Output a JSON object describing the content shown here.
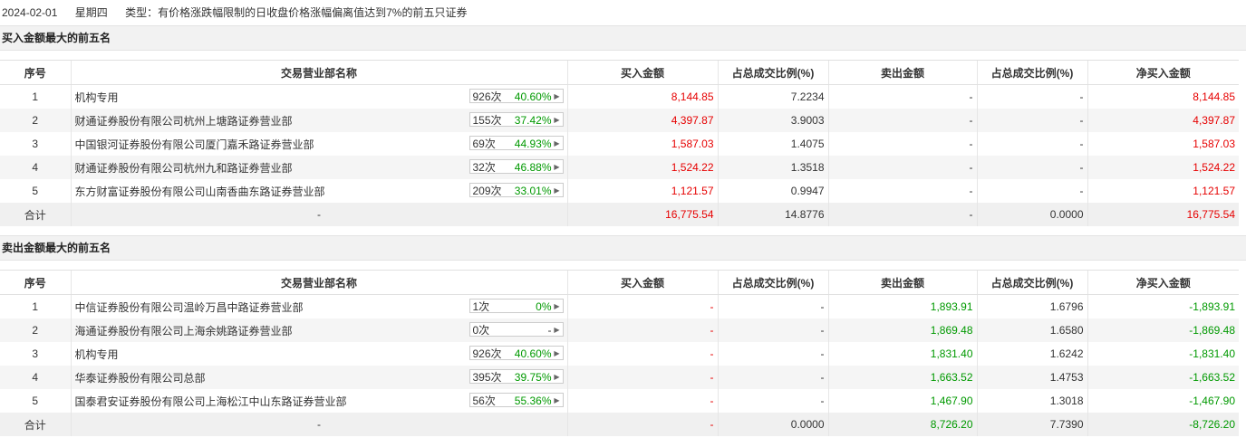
{
  "header": {
    "date": "2024-02-01",
    "weekday": "星期四",
    "type": "类型：有价格涨跌幅限制的日收盘价格涨幅偏离值达到7%的前五只证券"
  },
  "columns": [
    "序号",
    "交易营业部名称",
    "买入金额",
    "占总成交比例(%)",
    "卖出金额",
    "占总成交比例(%)",
    "净买入金额"
  ],
  "buy": {
    "title": "买入金额最大的前五名",
    "rows": [
      {
        "idx": "1",
        "name": "机构专用",
        "count": "926次",
        "pct": "40.60%",
        "buy": "8,144.85",
        "buy_ratio": "7.2234",
        "sell": "-",
        "sell_ratio": "-",
        "net": "8,144.85"
      },
      {
        "idx": "2",
        "name": "财通证券股份有限公司杭州上塘路证券营业部",
        "count": "155次",
        "pct": "37.42%",
        "buy": "4,397.87",
        "buy_ratio": "3.9003",
        "sell": "-",
        "sell_ratio": "-",
        "net": "4,397.87"
      },
      {
        "idx": "3",
        "name": "中国银河证券股份有限公司厦门嘉禾路证券营业部",
        "count": "69次",
        "pct": "44.93%",
        "buy": "1,587.03",
        "buy_ratio": "1.4075",
        "sell": "-",
        "sell_ratio": "-",
        "net": "1,587.03"
      },
      {
        "idx": "4",
        "name": "财通证券股份有限公司杭州九和路证券营业部",
        "count": "32次",
        "pct": "46.88%",
        "buy": "1,524.22",
        "buy_ratio": "1.3518",
        "sell": "-",
        "sell_ratio": "-",
        "net": "1,524.22"
      },
      {
        "idx": "5",
        "name": "东方财富证券股份有限公司山南香曲东路证券营业部",
        "count": "209次",
        "pct": "33.01%",
        "buy": "1,121.57",
        "buy_ratio": "0.9947",
        "sell": "-",
        "sell_ratio": "-",
        "net": "1,121.57"
      }
    ],
    "total": {
      "label": "合计",
      "name": "-",
      "buy": "16,775.54",
      "buy_ratio": "14.8776",
      "sell": "-",
      "sell_ratio": "0.0000",
      "net": "16,775.54"
    }
  },
  "sell": {
    "title": "卖出金额最大的前五名",
    "rows": [
      {
        "idx": "1",
        "name": "中信证券股份有限公司温岭万昌中路证券营业部",
        "count": "1次",
        "pct": "0%",
        "buy": "-",
        "buy_ratio": "-",
        "sell": "1,893.91",
        "sell_ratio": "1.6796",
        "net": "-1,893.91"
      },
      {
        "idx": "2",
        "name": "海通证券股份有限公司上海余姚路证券营业部",
        "count": "0次",
        "pct": "-",
        "buy": "-",
        "buy_ratio": "-",
        "sell": "1,869.48",
        "sell_ratio": "1.6580",
        "net": "-1,869.48"
      },
      {
        "idx": "3",
        "name": "机构专用",
        "count": "926次",
        "pct": "40.60%",
        "buy": "-",
        "buy_ratio": "-",
        "sell": "1,831.40",
        "sell_ratio": "1.6242",
        "net": "-1,831.40"
      },
      {
        "idx": "4",
        "name": "华泰证券股份有限公司总部",
        "count": "395次",
        "pct": "39.75%",
        "buy": "-",
        "buy_ratio": "-",
        "sell": "1,663.52",
        "sell_ratio": "1.4753",
        "net": "-1,663.52"
      },
      {
        "idx": "5",
        "name": "国泰君安证券股份有限公司上海松江中山东路证券营业部",
        "count": "56次",
        "pct": "55.36%",
        "buy": "-",
        "buy_ratio": "-",
        "sell": "1,467.90",
        "sell_ratio": "1.3018",
        "net": "-1,467.90"
      }
    ],
    "total": {
      "label": "合计",
      "name": "-",
      "buy": "-",
      "buy_ratio": "0.0000",
      "sell": "8,726.20",
      "sell_ratio": "7.7390",
      "net": "-8,726.20"
    }
  },
  "colors": {
    "up": "#e60000",
    "down": "#009900"
  }
}
